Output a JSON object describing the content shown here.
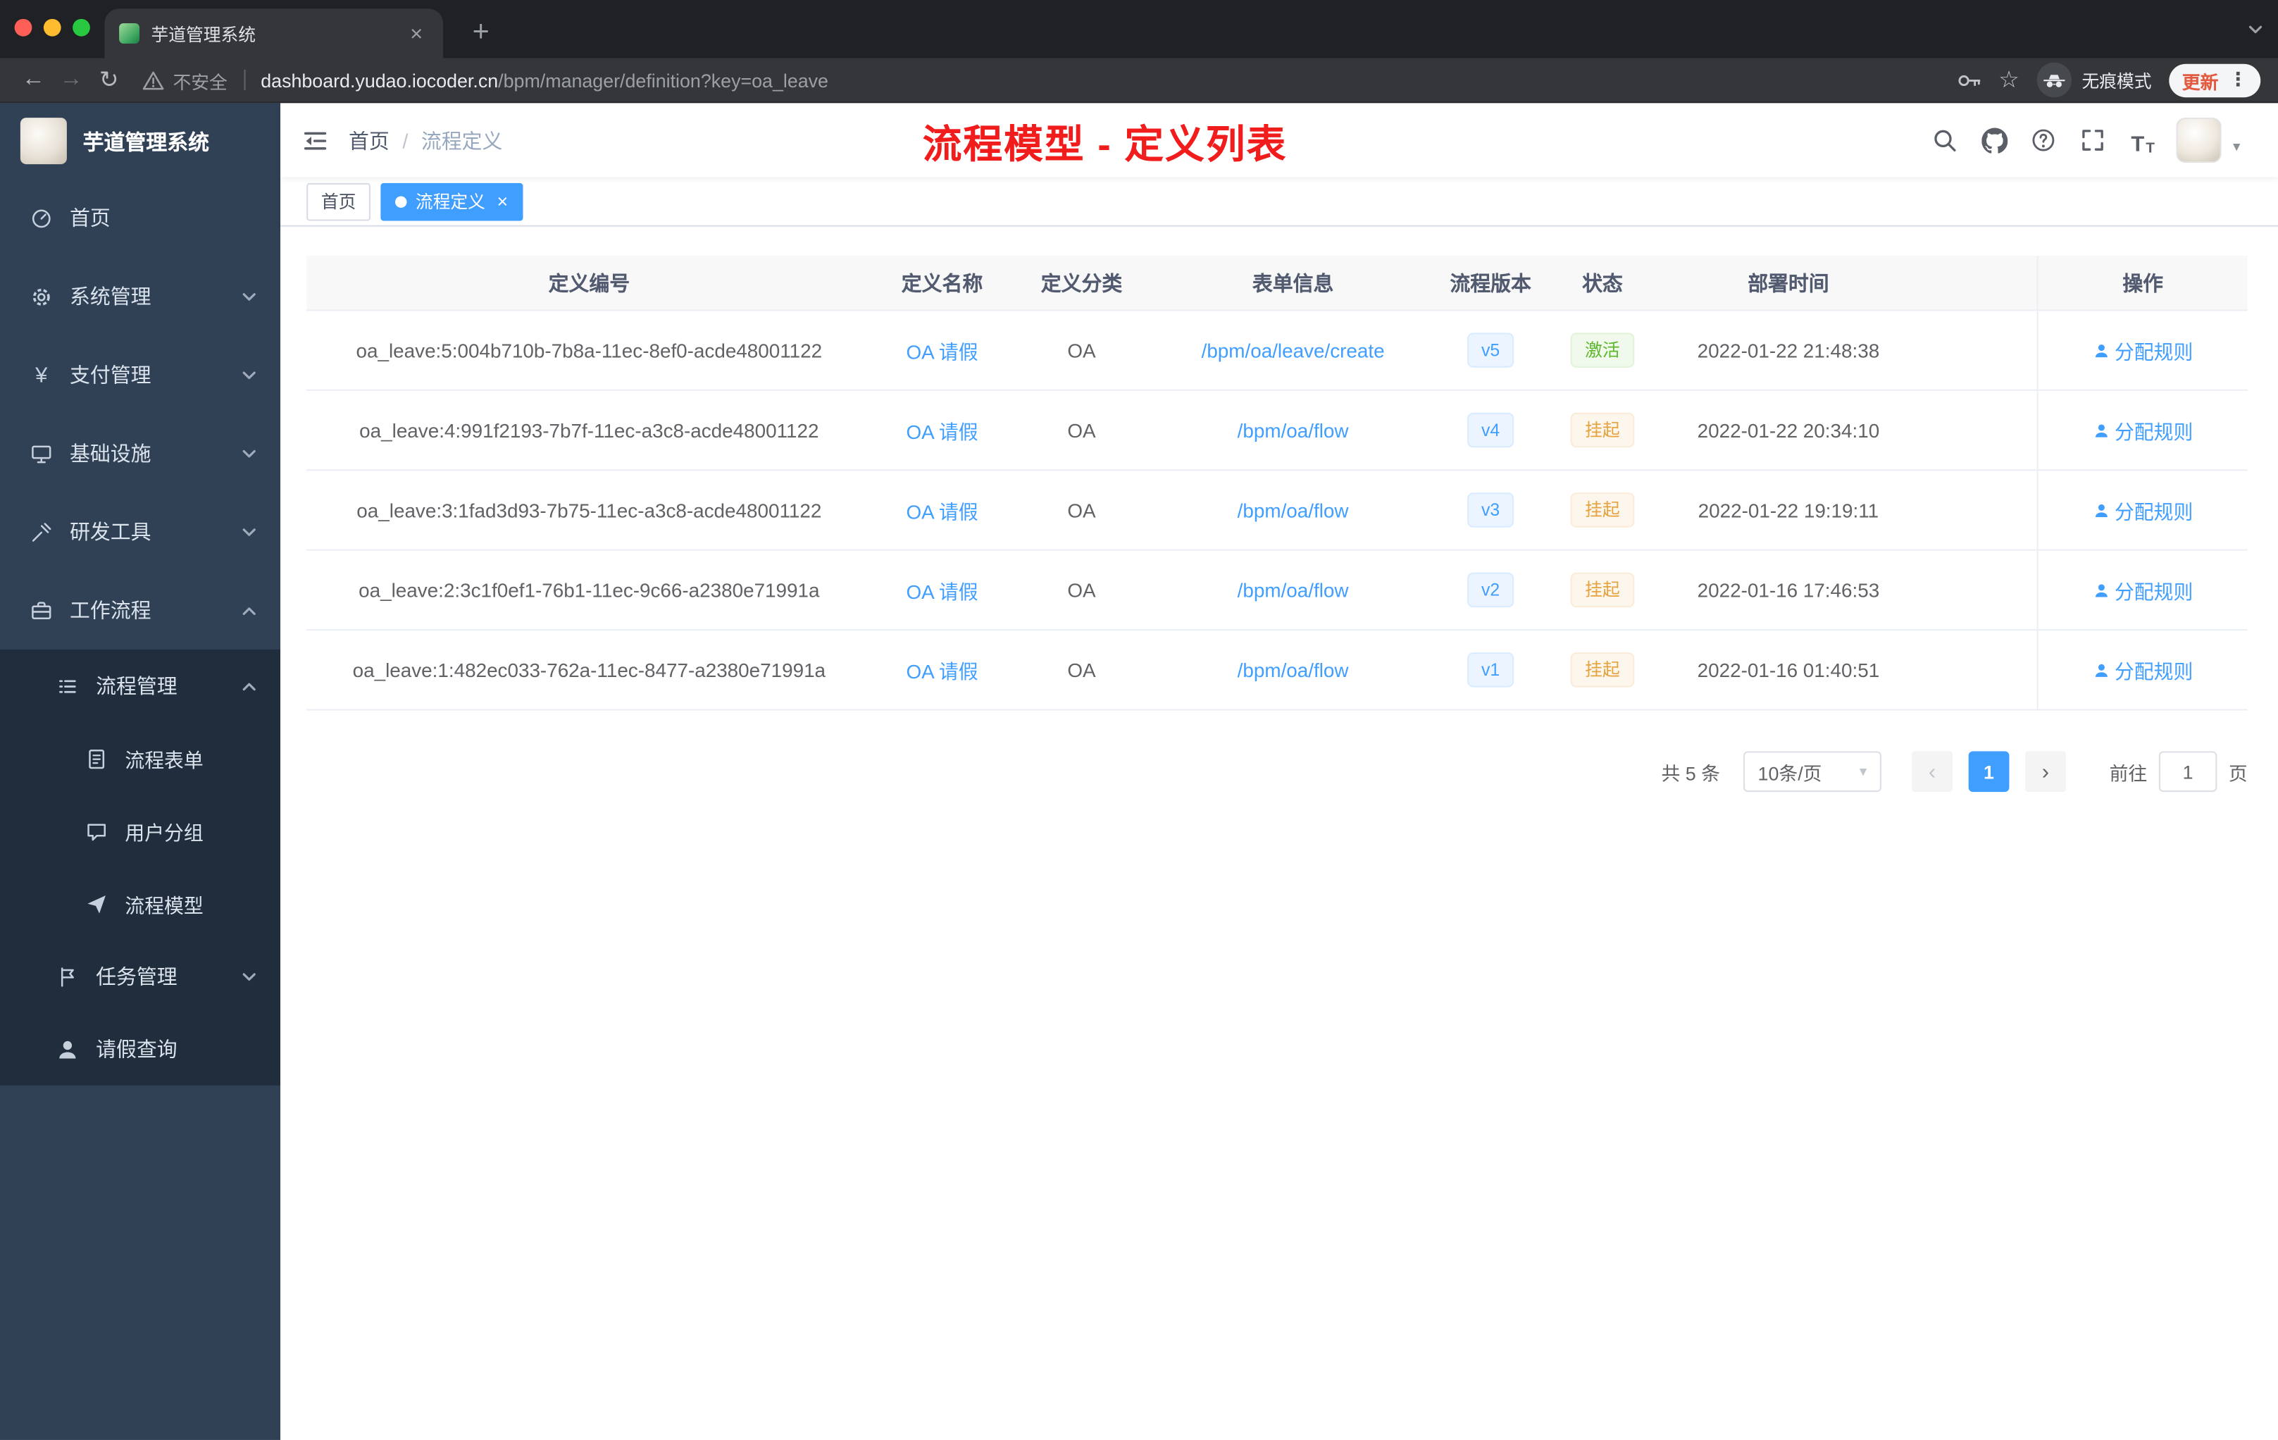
{
  "browser": {
    "tab_title": "芋道管理系统",
    "close_tab": "×",
    "new_tab": "+",
    "back": "←",
    "forward": "→",
    "reload": "↻",
    "security_label": "不安全",
    "url_host": "dashboard.yudao.iocoder.cn",
    "url_path": "/bpm/manager/definition?key=oa_leave",
    "incognito_label": "无痕模式",
    "update_label": "更新",
    "menu_dots": "⋮",
    "star": "☆"
  },
  "sidebar": {
    "app_title": "芋道管理系统",
    "items": [
      {
        "label": "首页"
      },
      {
        "label": "系统管理"
      },
      {
        "label": "支付管理"
      },
      {
        "label": "基础设施"
      },
      {
        "label": "研发工具"
      },
      {
        "label": "工作流程"
      },
      {
        "label": "流程管理"
      },
      {
        "label": "流程表单"
      },
      {
        "label": "用户分组"
      },
      {
        "label": "流程模型"
      },
      {
        "label": "任务管理"
      },
      {
        "label": "请假查询"
      }
    ]
  },
  "header": {
    "breadcrumb_home": "首页",
    "breadcrumb_sep": "/",
    "breadcrumb_current": "流程定义",
    "annotation": "流程模型 - 定义列表",
    "font_size_icon_text": "T"
  },
  "tags": {
    "home": "首页",
    "current": "流程定义",
    "close": "×"
  },
  "table": {
    "columns": [
      "定义编号",
      "定义名称",
      "定义分类",
      "表单信息",
      "流程版本",
      "状态",
      "部署时间",
      "操作"
    ],
    "action_label": "分配规则",
    "rows": [
      {
        "id": "oa_leave:5:004b710b-7b8a-11ec-8ef0-acde48001122",
        "name": "OA 请假",
        "category": "OA",
        "form": "/bpm/oa/leave/create",
        "version": "v5",
        "status": "激活",
        "time": "2022-01-22 21:48:38"
      },
      {
        "id": "oa_leave:4:991f2193-7b7f-11ec-a3c8-acde48001122",
        "name": "OA 请假",
        "category": "OA",
        "form": "/bpm/oa/flow",
        "version": "v4",
        "status": "挂起",
        "time": "2022-01-22 20:34:10"
      },
      {
        "id": "oa_leave:3:1fad3d93-7b75-11ec-a3c8-acde48001122",
        "name": "OA 请假",
        "category": "OA",
        "form": "/bpm/oa/flow",
        "version": "v3",
        "status": "挂起",
        "time": "2022-01-22 19:19:11"
      },
      {
        "id": "oa_leave:2:3c1f0ef1-76b1-11ec-9c66-a2380e71991a",
        "name": "OA 请假",
        "category": "OA",
        "form": "/bpm/oa/flow",
        "version": "v2",
        "status": "挂起",
        "time": "2022-01-16 17:46:53"
      },
      {
        "id": "oa_leave:1:482ec033-762a-11ec-8477-a2380e71991a",
        "name": "OA 请假",
        "category": "OA",
        "form": "/bpm/oa/flow",
        "version": "v1",
        "status": "挂起",
        "time": "2022-01-16 01:40:51"
      }
    ]
  },
  "pagination": {
    "total": "共 5 条",
    "page_size": "10条/页",
    "size_caret": "▾",
    "prev": "‹",
    "next": "›",
    "page": "1",
    "goto_label": "前往",
    "goto_value": "1",
    "unit": "页"
  },
  "colors": {
    "accent": "#409eff",
    "success_text": "#5cb82a",
    "success_bg": "#f0f9eb",
    "warning_text": "#e6a23c",
    "warning_bg": "#fdf6ec",
    "annotation_red": "#f11d1d",
    "sidebar_bg": "#304156",
    "submenu_bg": "#1f2d3d",
    "active_tag_bg": "#409eff"
  },
  "icons": {
    "search-icon": "magnifier",
    "github-icon": "github octocat",
    "help-icon": "question circle",
    "fullscreen-icon": "expand corners",
    "font-size-icon": "TT",
    "hamburger-icon": "menu fold",
    "dashboard-icon": "gauge",
    "gear-icon": "gear",
    "yen-icon": "¥",
    "infrastructure-icon": "monitor",
    "tools-icon": "tools",
    "workflow-icon": "briefcase",
    "process-list-icon": "bulleted list",
    "form-icon": "document",
    "user-group-icon": "chat bubble",
    "process-model-icon": "paper plane",
    "task-icon": "flag",
    "person-icon": "person silhouette",
    "key-icon": "key",
    "warning-icon": "warning triangle",
    "incognito-icon": "spy hat and glasses"
  }
}
